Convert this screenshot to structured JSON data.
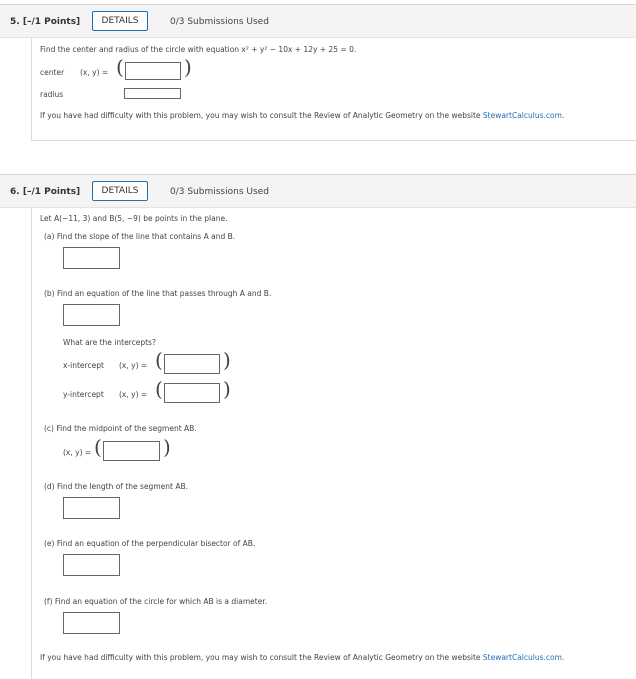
{
  "q5": {
    "number": "5.",
    "points": "[–/1 Points]",
    "details_label": "DETAILS",
    "submissions": "0/3 Submissions Used",
    "prompt": "Find the center and radius of the circle with equation x² + y² − 10x + 12y + 25 = 0.",
    "center_label": "center",
    "center_xy": "(x, y) =",
    "radius_label": "radius",
    "help_prefix": "If you have had difficulty with this problem, you may wish to consult the Review of Analytic Geometry on the website ",
    "help_link": "StewartCalculus.com",
    "help_suffix": "."
  },
  "q6": {
    "number": "6.",
    "points": "[–/1 Points]",
    "details_label": "DETAILS",
    "submissions": "0/3 Submissions Used",
    "intro": "Let A(−11, 3) and B(5, −9) be points in the plane.",
    "a": "(a)   Find the slope of the line that contains A and B.",
    "b": "(b)   Find an equation of the line that passes through A and B.",
    "intercepts_q": "What are the intercepts?",
    "x_intercept_label": "x-intercept",
    "y_intercept_label": "y-intercept",
    "xy": "(x, y)  =",
    "c": "(c)   Find the midpoint of the segment AB.",
    "c_xy": "(x, y) =",
    "d": "(d)   Find the length of the segment AB.",
    "e": "(e)   Find an equation of the perpendicular bisector of AB.",
    "f": "(f)   Find an equation of the circle for which AB is a diameter.",
    "help_prefix": "If you have had difficulty with this problem, you may wish to consult the Review of Analytic Geometry on the website ",
    "help_link": "StewartCalculus.com",
    "help_suffix": "."
  }
}
